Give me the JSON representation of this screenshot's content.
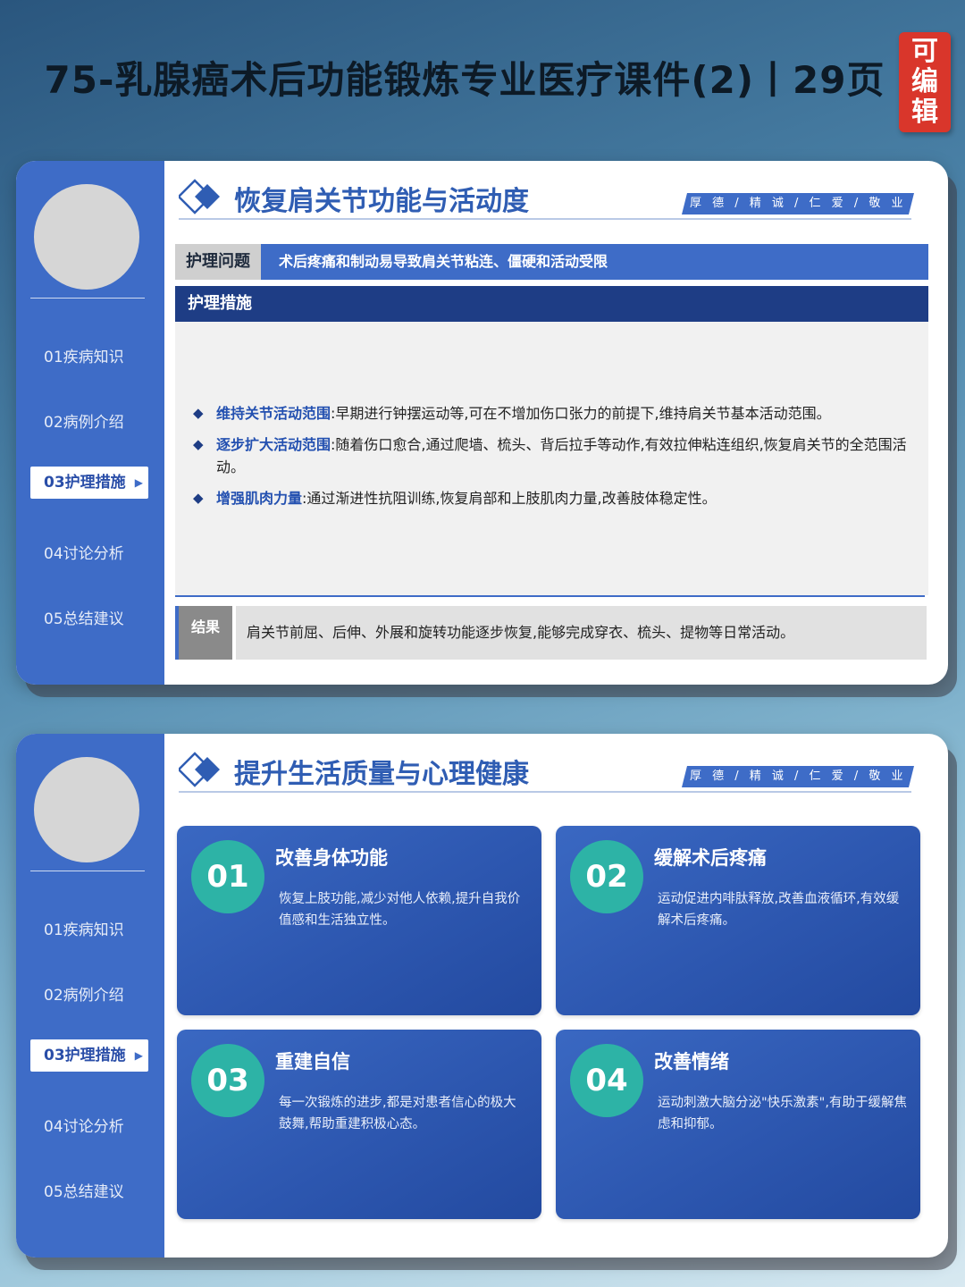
{
  "page_title": "75-乳腺癌术后功能锻炼专业医疗课件(2)丨29页",
  "edit_badge": [
    "可",
    "编",
    "辑"
  ],
  "sidebar": {
    "items": [
      "01疾病知识",
      "02病例介绍",
      "03护理措施",
      "04讨论分析",
      "05总结建议"
    ],
    "active_index": 2
  },
  "motto": "厚 德 / 精 诚 / 仁 爱 / 敬 业",
  "slide1": {
    "title": "恢复肩关节功能与活动度",
    "problem_label": "护理问题",
    "problem_text": "术后疼痛和制动易导致肩关节粘连、僵硬和活动受限",
    "measures_label": "护理措施",
    "bullets": [
      {
        "key": "维持关节活动范围",
        "text": ":早期进行钟摆运动等,可在不增加伤口张力的前提下,维持肩关节基本活动范围。"
      },
      {
        "key": "逐步扩大活动范围",
        "text": ":随着伤口愈合,通过爬墙、梳头、背后拉手等动作,有效拉伸粘连组织,恢复肩关节的全范围活动。"
      },
      {
        "key": "增强肌肉力量",
        "text": ":通过渐进性抗阻训练,恢复肩部和上肢肌肉力量,改善肢体稳定性。"
      }
    ],
    "result_label": "结果",
    "result_text": "肩关节前屈、后伸、外展和旋转功能逐步恢复,能够完成穿衣、梳头、提物等日常活动。"
  },
  "slide2": {
    "title": "提升生活质量与心理健康",
    "cards": [
      {
        "num": "01",
        "title": "改善身体功能",
        "text": "恢复上肢功能,减少对他人依赖,提升自我价值感和生活独立性。"
      },
      {
        "num": "02",
        "title": "缓解术后疼痛",
        "text": "运动促进内啡肽释放,改善血液循环,有效缓解术后疼痛。"
      },
      {
        "num": "03",
        "title": "重建自信",
        "text": "每一次锻炼的进步,都是对患者信心的极大鼓舞,帮助重建积极心态。"
      },
      {
        "num": "04",
        "title": "改善情绪",
        "text": "运动刺激大脑分泌\"快乐激素\",有助于缓解焦虑和抑郁。"
      }
    ]
  },
  "colors": {
    "primary_blue": "#3e6cc7",
    "dark_navy": "#1e3d85",
    "teal": "#2db3a6",
    "badge_red": "#d9362b"
  }
}
